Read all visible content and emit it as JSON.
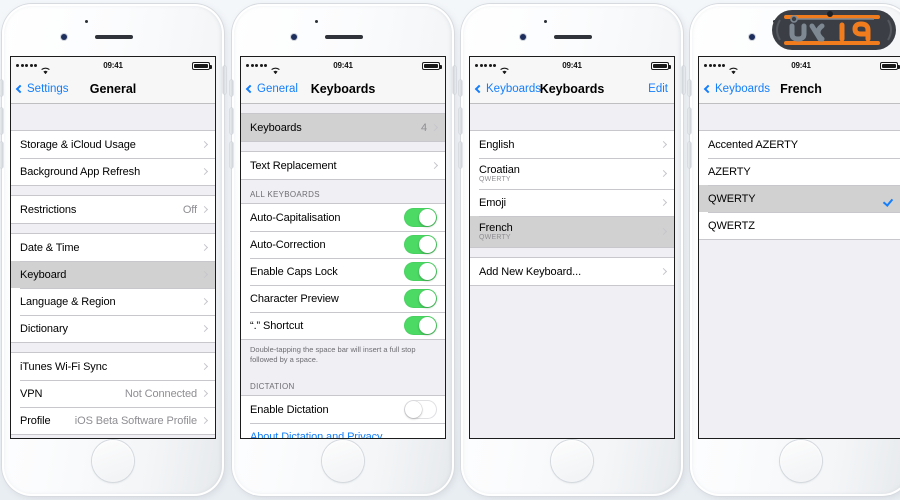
{
  "background_color": "#f1f4f7",
  "accent_color": "#147efb",
  "toggle_on_color": "#4cd964",
  "selected_row_color": "#d1d1d1",
  "statusbar": {
    "time": "09:41",
    "carrier_dots": 5,
    "wifi": "wifi-icon",
    "battery": "battery-icon"
  },
  "watermark": {
    "text": "ایران",
    "alt": "persian-logo-watermark"
  },
  "phones": [
    {
      "id": "phone-general",
      "nav": {
        "back": "Settings",
        "title": "General",
        "right": ""
      },
      "sections": [
        {
          "top_gap": "lg",
          "rows": [
            {
              "label": "Storage & iCloud Usage",
              "value": "",
              "chevron": true,
              "selected": false
            },
            {
              "label": "Background App Refresh",
              "value": "",
              "chevron": true,
              "selected": false
            }
          ]
        },
        {
          "top_gap": "sm",
          "rows": [
            {
              "label": "Restrictions",
              "value": "Off",
              "chevron": true,
              "selected": false
            }
          ]
        },
        {
          "top_gap": "sm",
          "rows": [
            {
              "label": "Date & Time",
              "value": "",
              "chevron": true,
              "selected": false
            },
            {
              "label": "Keyboard",
              "value": "",
              "chevron": true,
              "selected": true
            },
            {
              "label": "Language & Region",
              "value": "",
              "chevron": true,
              "selected": false
            },
            {
              "label": "Dictionary",
              "value": "",
              "chevron": true,
              "selected": false
            }
          ]
        },
        {
          "top_gap": "sm",
          "rows": [
            {
              "label": "iTunes Wi-Fi Sync",
              "value": "",
              "chevron": true,
              "selected": false
            },
            {
              "label": "VPN",
              "value": "Not Connected",
              "chevron": true,
              "selected": false
            },
            {
              "label": "Profile",
              "value": "iOS Beta Software Profile",
              "chevron": true,
              "selected": false
            }
          ]
        }
      ]
    },
    {
      "id": "phone-keyboards-settings",
      "nav": {
        "back": "General",
        "title": "Keyboards",
        "right": ""
      },
      "sections": [
        {
          "top_gap": "sm",
          "rows": [
            {
              "label": "Keyboards",
              "value": "4",
              "chevron": true,
              "selected": true
            }
          ]
        },
        {
          "top_gap": "sm",
          "rows": [
            {
              "label": "Text Replacement",
              "value": "",
              "chevron": true,
              "selected": false
            }
          ]
        },
        {
          "header": "ALL KEYBOARDS",
          "rows": [
            {
              "label": "Auto-Capitalisation",
              "toggle": "on"
            },
            {
              "label": "Auto-Correction",
              "toggle": "on"
            },
            {
              "label": "Enable Caps Lock",
              "toggle": "on"
            },
            {
              "label": "Character Preview",
              "toggle": "on"
            },
            {
              "label": "“.” Shortcut",
              "toggle": "on"
            }
          ],
          "footer": "Double-tapping the space bar will insert a full stop followed by a space."
        },
        {
          "header": "DICTATION",
          "rows": [
            {
              "label": "Enable Dictation",
              "toggle": "off"
            },
            {
              "label": "About Dictation and Privacy...",
              "link": true
            }
          ]
        }
      ]
    },
    {
      "id": "phone-keyboards-list",
      "nav": {
        "back": "Keyboards",
        "title": "Keyboards",
        "right": "Edit"
      },
      "sections": [
        {
          "top_gap": "lg",
          "rows": [
            {
              "label": "English",
              "sub": "",
              "chevron": true,
              "selected": false
            },
            {
              "label": "Croatian",
              "sub": "QWERTY",
              "chevron": true,
              "selected": false
            },
            {
              "label": "Emoji",
              "sub": "",
              "chevron": true,
              "selected": false
            },
            {
              "label": "French",
              "sub": "QWERTY",
              "chevron": true,
              "selected": true
            }
          ]
        },
        {
          "top_gap": "sm",
          "rows": [
            {
              "label": "Add New Keyboard...",
              "sub": "",
              "chevron": true,
              "selected": false
            }
          ]
        }
      ]
    },
    {
      "id": "phone-french-layouts",
      "nav": {
        "back": "Keyboards",
        "title": "French",
        "right": ""
      },
      "sections": [
        {
          "top_gap": "lg",
          "rows": [
            {
              "label": "Accented AZERTY",
              "checked": false,
              "selected": false
            },
            {
              "label": "AZERTY",
              "checked": false,
              "selected": false
            },
            {
              "label": "QWERTY",
              "checked": true,
              "selected": true
            },
            {
              "label": "QWERTZ",
              "checked": false,
              "selected": false
            }
          ]
        }
      ]
    }
  ]
}
